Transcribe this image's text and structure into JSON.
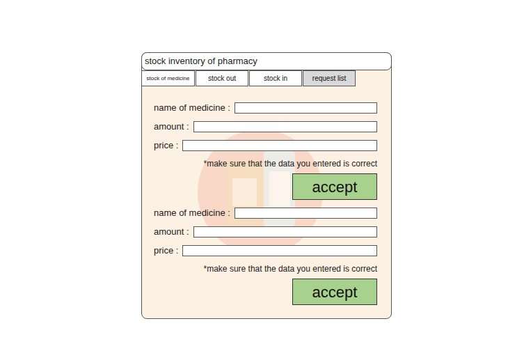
{
  "window": {
    "title": "stock inventory of pharmacy"
  },
  "tabs": [
    {
      "label": "stock of medicine",
      "selected": false
    },
    {
      "label": "stock out",
      "selected": false
    },
    {
      "label": "stock in",
      "selected": false
    },
    {
      "label": "request list",
      "selected": true
    }
  ],
  "forms": [
    {
      "fields": [
        {
          "label": "name of medicine :"
        },
        {
          "label": "amount :"
        },
        {
          "label": "price :"
        }
      ],
      "note": "*make sure that the data you entered is correct",
      "button": "accept"
    },
    {
      "fields": [
        {
          "label": "name of medicine :"
        },
        {
          "label": "amount :"
        },
        {
          "label": "price :"
        }
      ],
      "note": "*make sure that the data you entered is correct",
      "button": "accept"
    }
  ]
}
